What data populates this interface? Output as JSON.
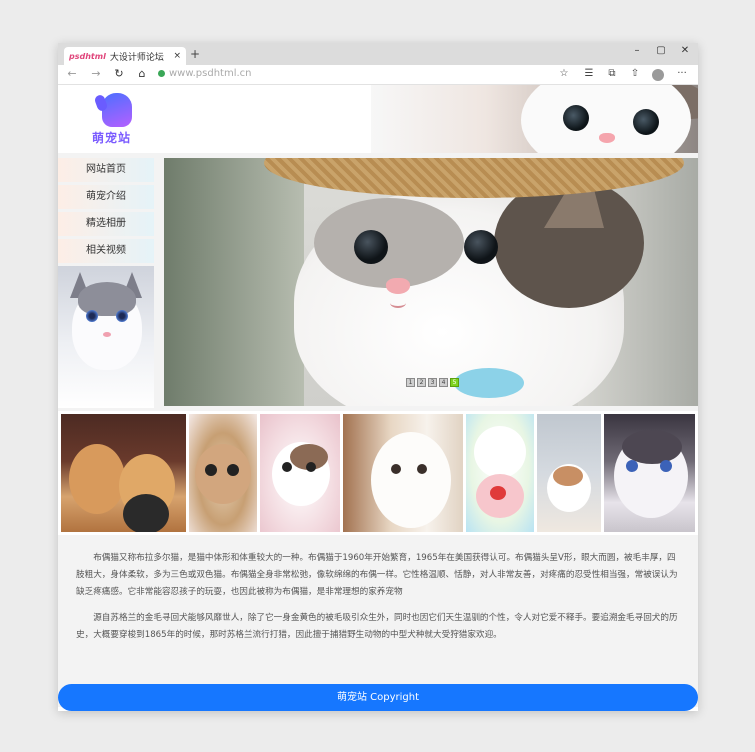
{
  "browser": {
    "tab_title": "大设计师论坛",
    "tab_favicon_text": "psdhtml",
    "tab_close": "×",
    "new_tab": "+",
    "url": "www.psdhtml.cn",
    "nav": {
      "back": "←",
      "forward": "→",
      "reload": "↻",
      "home": "⌂"
    },
    "window_controls": {
      "minimize": "–",
      "maximize": "▢",
      "close": "✕"
    },
    "toolbar_icons": [
      "star-icon",
      "favorites-icon",
      "collections-icon",
      "share-icon",
      "profile-icon",
      "more-icon"
    ],
    "toolbar_glyphs": {
      "star": "☆",
      "favorites": "☰",
      "collections": "⧉",
      "share": "⇧",
      "more": "···"
    }
  },
  "site": {
    "logo_text": "萌宠站",
    "menu": [
      "网站首页",
      "萌宠介绍",
      "精选相册",
      "相关视频"
    ],
    "banner": {
      "dots": [
        "1",
        "2",
        "3",
        "4",
        "5"
      ],
      "active_dot": 5
    },
    "gallery_count": 7,
    "paragraphs": [
      "布偶猫又称布拉多尔猫，是猫中体形和体重较大的一种。布偶猫于1960年开始繁育，1965年在美国获得认可。布偶猫头呈V形，眼大而圆，被毛丰厚，四肢粗大，身体柔软，多为三色或双色猫。布偶猫全身非常松弛，像软绵绵的布偶一样。它性格温顺、恬静，对人非常友善，对疼痛的忍受性相当强，常被误认为缺乏疼痛感。它非常能容忍孩子的玩耍，也因此被称为布偶猫，是非常理想的家养宠物",
      "源自苏格兰的金毛寻回犬能够风靡世人，除了它一身金黄色的被毛吸引众生外，同时也因它们天生温驯的个性，令人对它爱不释手。要追溯金毛寻回犬的历史，大概要穿梭到1865年的时候，那时苏格兰流行打猎，因此擅于捕猎野生动物的中型犬种就大受狩猎家欢迎。"
    ],
    "footer": "萌宠站  Copyright"
  },
  "colors": {
    "accent": "#1677ff",
    "logo": "#7b5cff",
    "active_dot": "#7ed321"
  }
}
